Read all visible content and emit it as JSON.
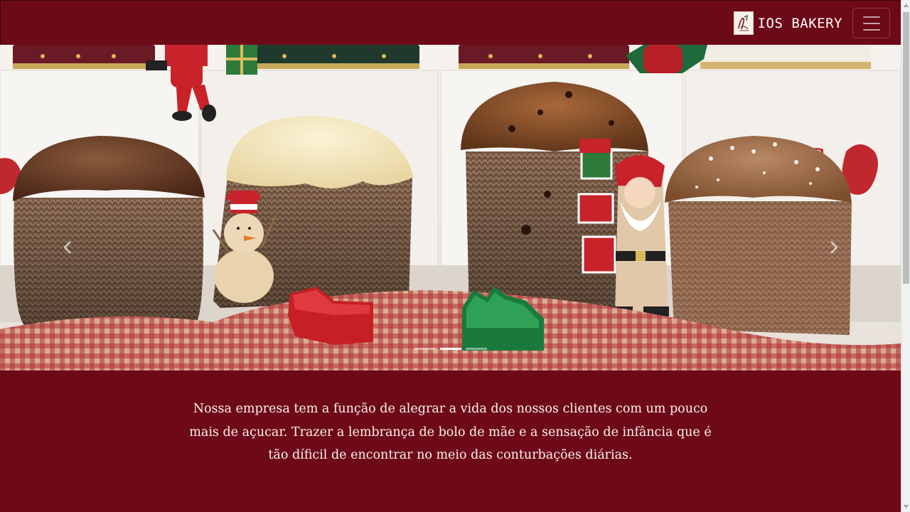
{
  "navbar": {
    "brand_text": "IOS BAKERY",
    "logo_icon": "bakery-logo",
    "toggler_icon": "hamburger-menu-icon"
  },
  "carousel": {
    "image_alt": "Panettones natalinos com decoração de Natal",
    "prev_icon": "chevron-left-icon",
    "next_icon": "chevron-right-icon",
    "slide_count": 3,
    "active_slide": 2
  },
  "about": {
    "text": "Nossa empresa tem a função de alegrar a vida dos nossos clientes com um pouco mais de açucar. Trazer a lembrança de bolo de mãe e a sensação de infância que é tão díficil de encontrar no meio das conturbações diárias."
  },
  "colors": {
    "brand_red": "#6e0a18",
    "text_light": "#fbf1ef"
  }
}
